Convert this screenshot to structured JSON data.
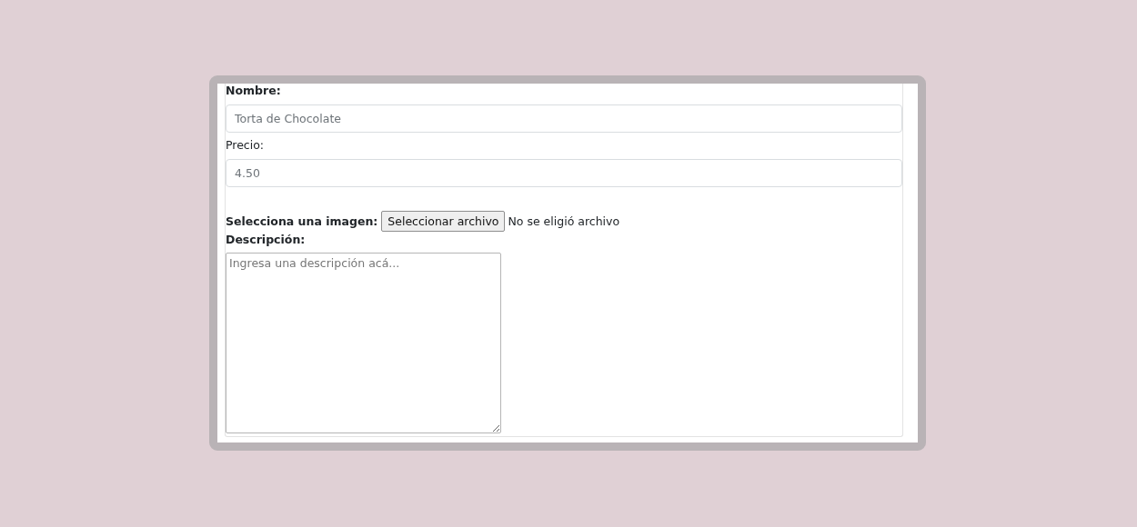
{
  "form": {
    "name": {
      "label": "Nombre:",
      "value": "Torta de Chocolate"
    },
    "price": {
      "label": "Precio:",
      "value": "4.50"
    },
    "image": {
      "label": "Selecciona una imagen:",
      "button": "Seleccionar archivo",
      "status": "No se eligió archivo"
    },
    "description": {
      "label": "Descripción:",
      "placeholder": "Ingresa una descripción acá..."
    }
  }
}
